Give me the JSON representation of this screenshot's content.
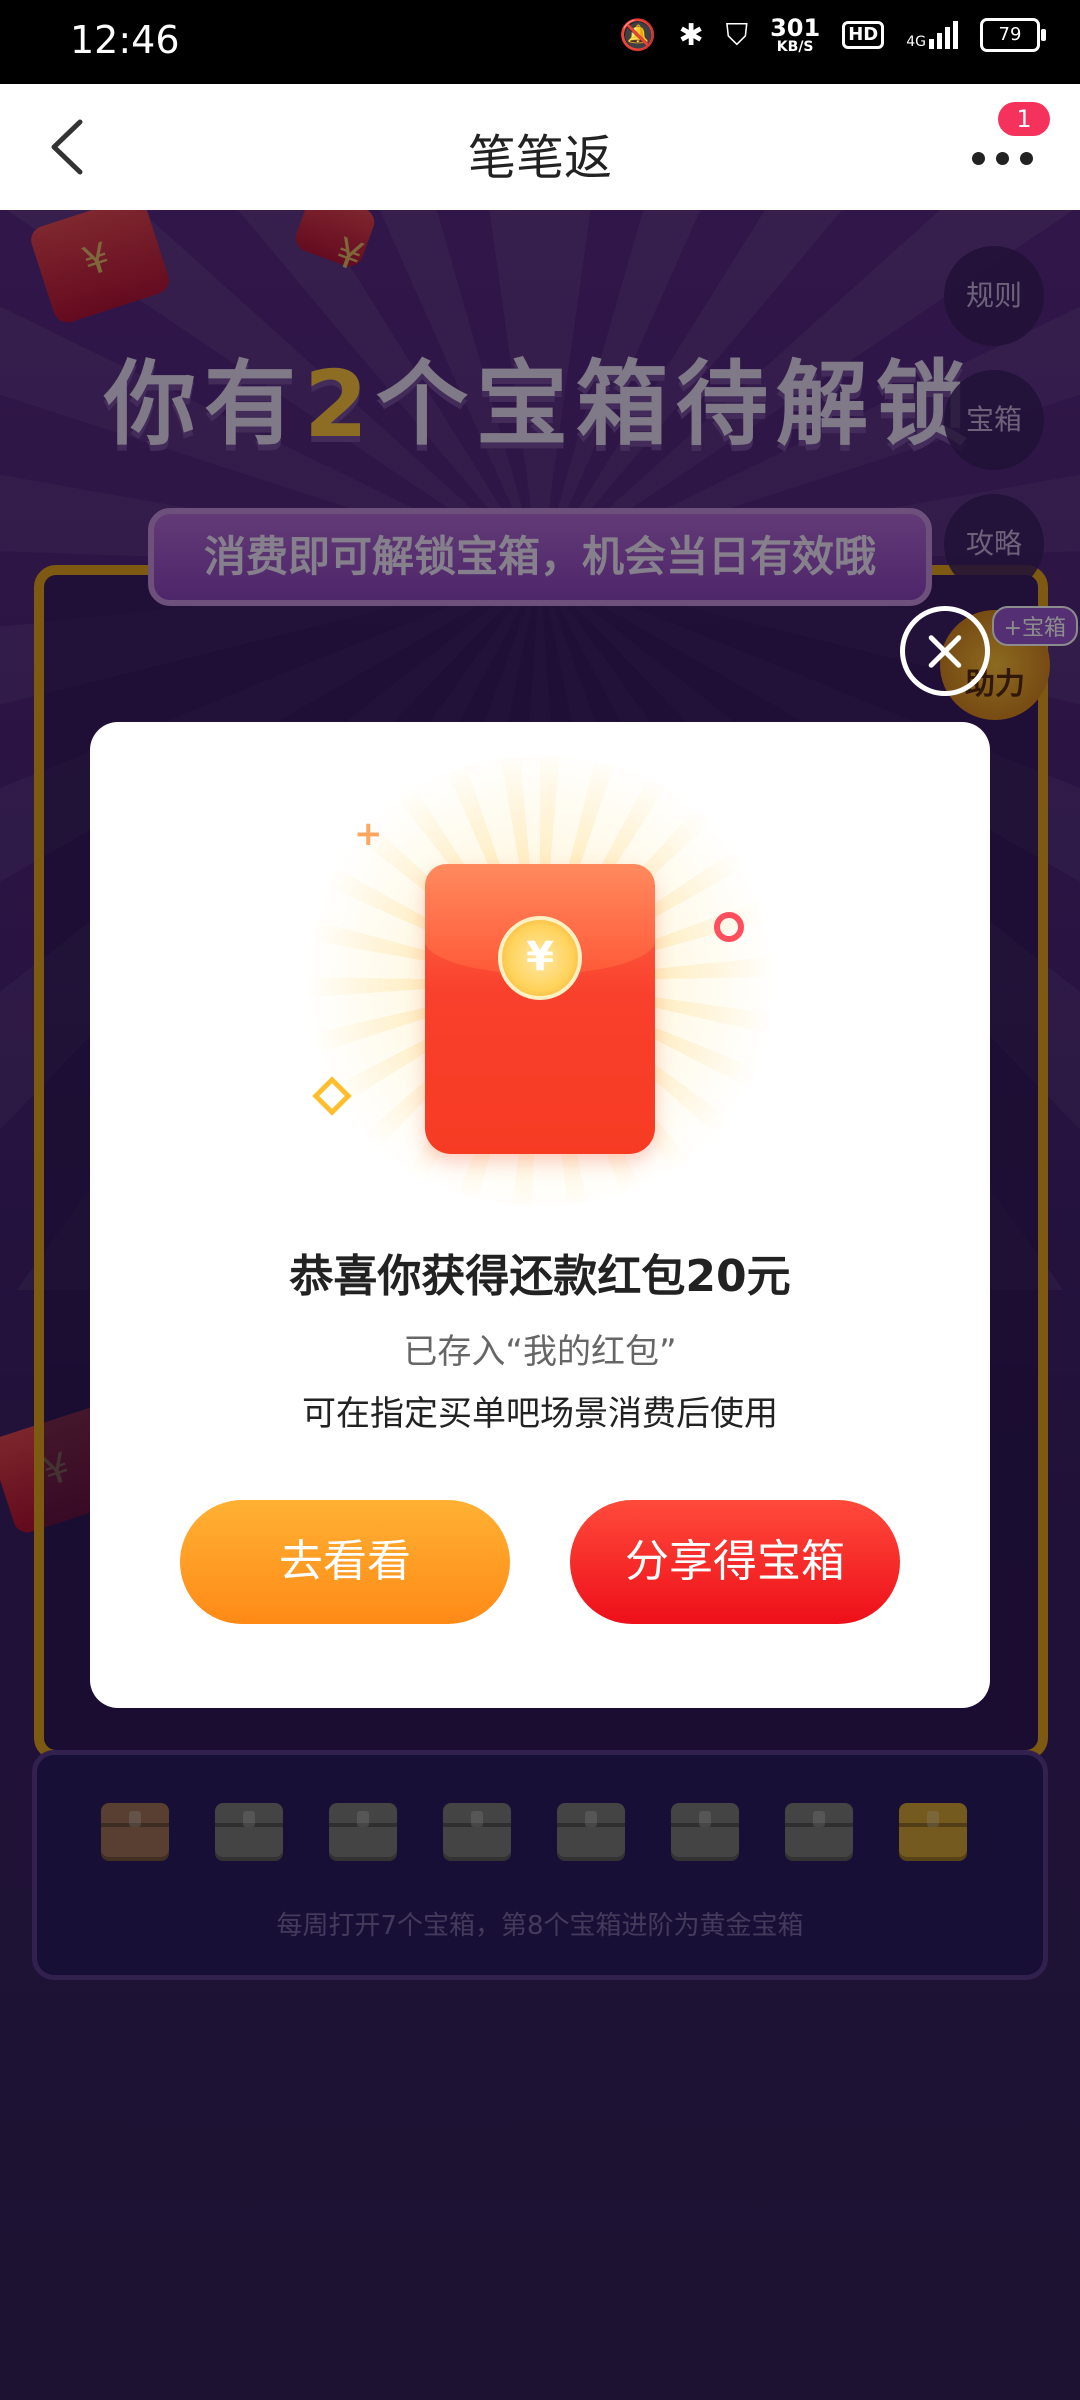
{
  "status_bar": {
    "time": "12:46",
    "net_speed": "301",
    "net_unit": "KB/S",
    "hd_label": "HD",
    "signal_label": "4G",
    "battery": "79"
  },
  "nav": {
    "title": "笔笔返",
    "badge_count": "1"
  },
  "banner": {
    "headline_pre": "你有",
    "headline_num": "2",
    "headline_post": "个宝箱待解锁",
    "subtitle": "消费即可解锁宝箱，机会当日有效哦"
  },
  "side_buttons": {
    "rules": "规则",
    "chest": "宝箱",
    "guide": "攻略",
    "assist": "助力",
    "assist_tag": "+宝箱"
  },
  "chest_bar": {
    "note": "每周打开7个宝箱，第8个宝箱进阶为黄金宝箱",
    "chests": [
      "opened",
      "locked",
      "locked",
      "locked",
      "locked",
      "locked",
      "locked",
      "gold"
    ]
  },
  "dialog": {
    "coin_symbol": "¥",
    "title": "恭喜你获得还款红包20元",
    "subtitle": "已存入“我的红包”",
    "description": "可在指定买单吧场景消费后使用",
    "primary_button": "去看看",
    "secondary_button": "分享得宝箱"
  },
  "colors": {
    "accent_orange": "#ff8a16",
    "accent_red": "#ee0f19",
    "badge": "#f5325c",
    "background": "#35215a"
  }
}
